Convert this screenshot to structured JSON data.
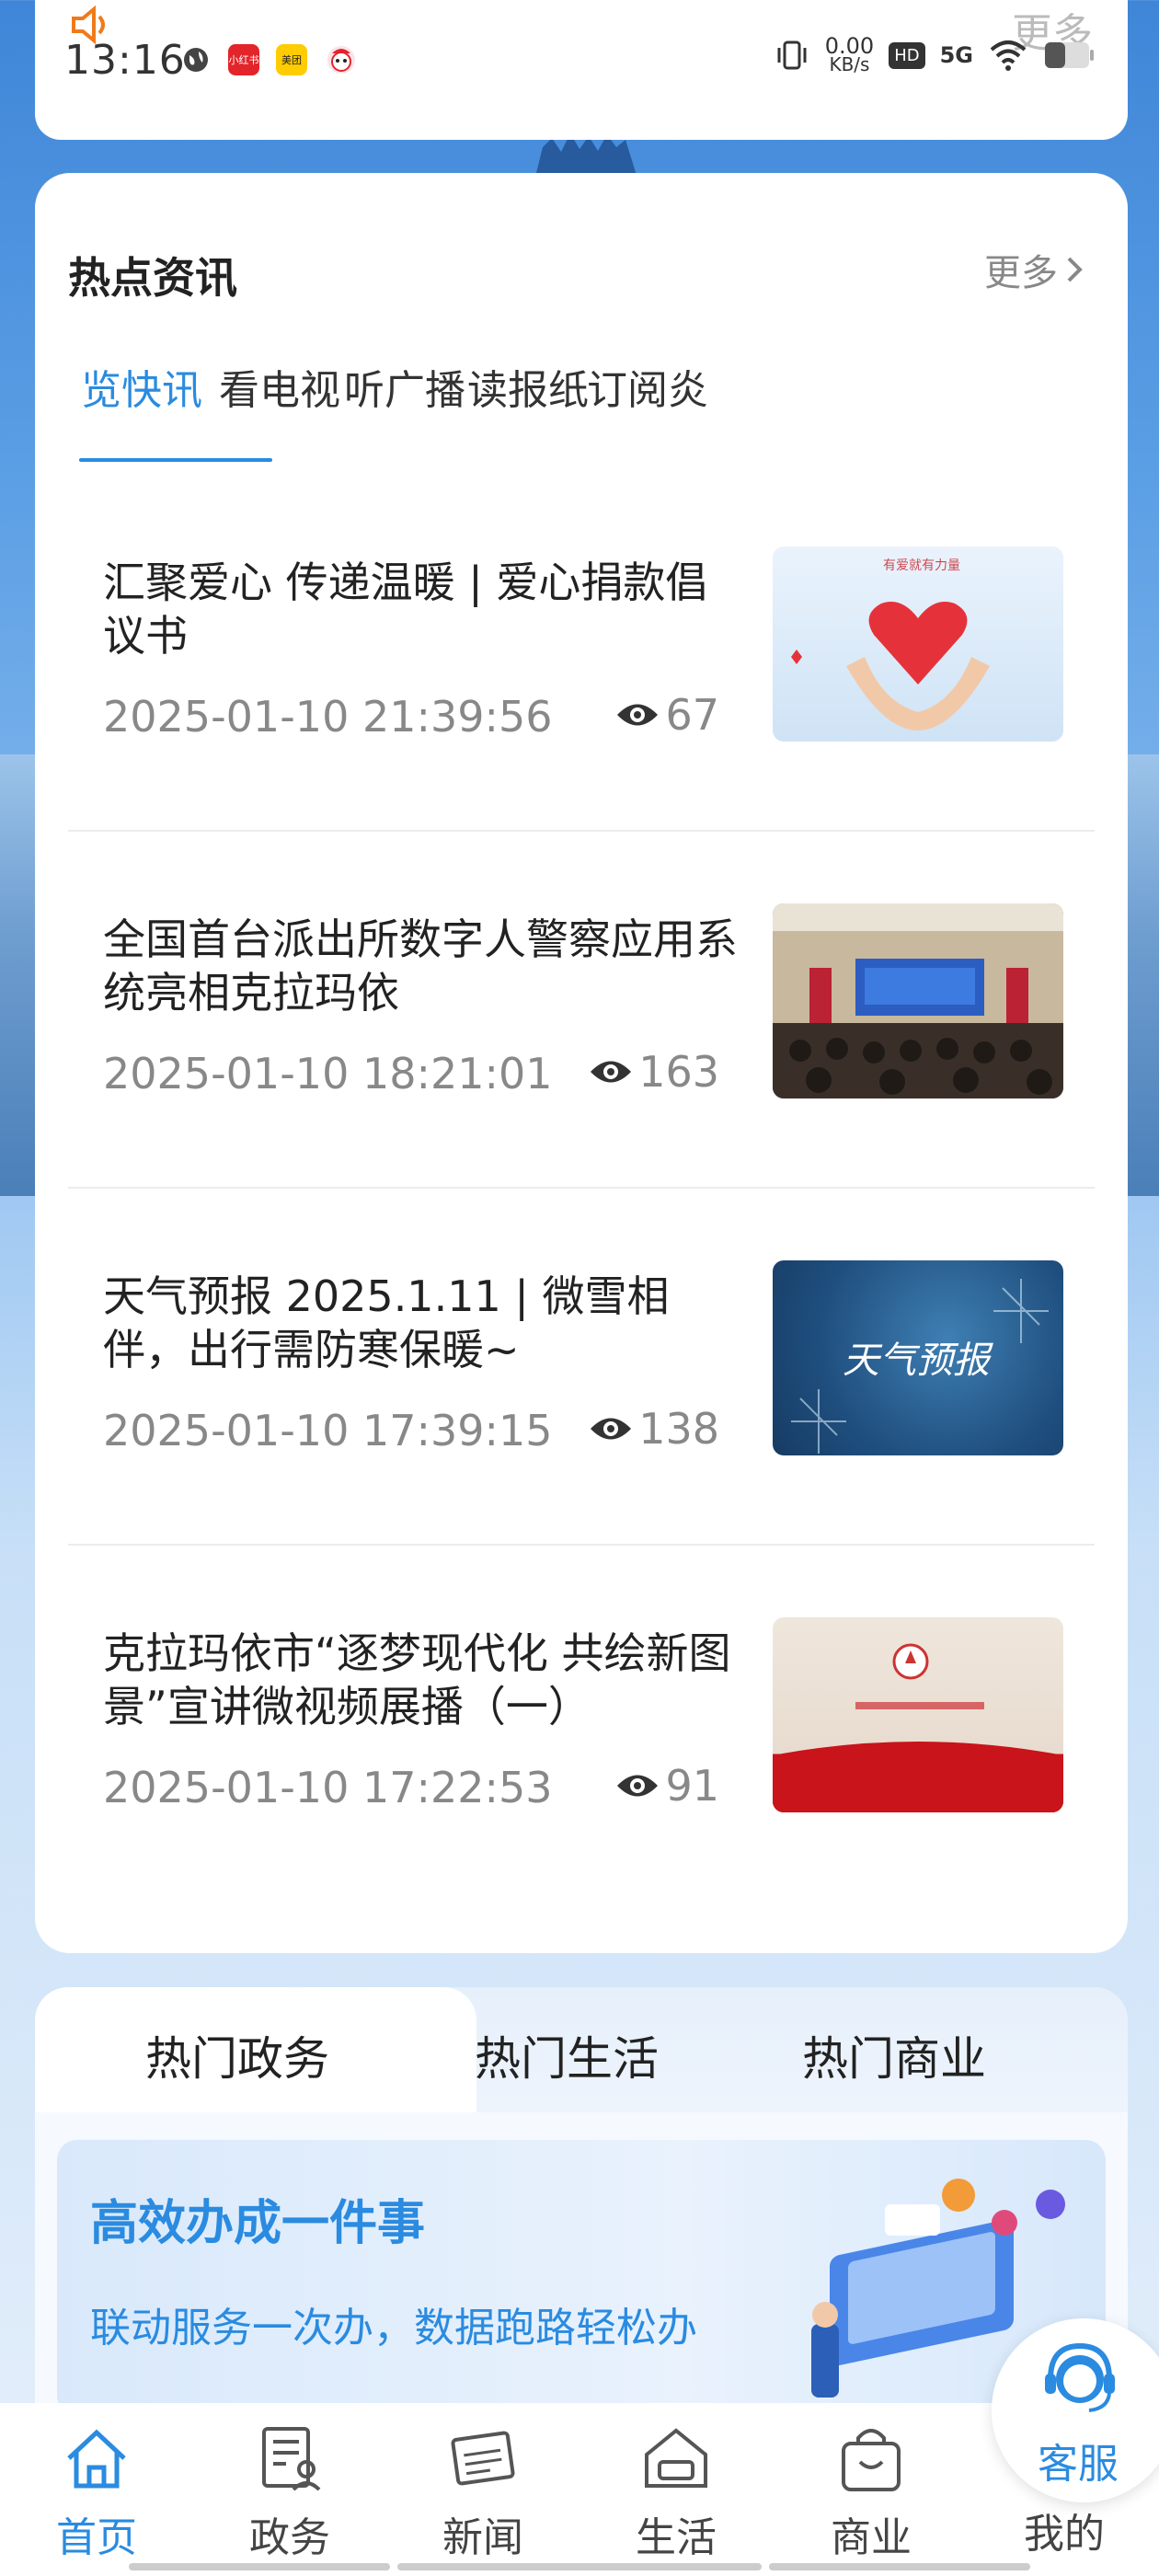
{
  "status_bar": {
    "time": "13:16",
    "speed_value": "0.00",
    "speed_unit": "KB/s",
    "hd": "HD",
    "net": "5G",
    "ghost_more": "更多",
    "apps": [
      "小红书",
      "美团"
    ]
  },
  "news": {
    "section_title": "热点资讯",
    "more_label": "更多",
    "tabs": [
      "览快讯",
      "看电视",
      "听广播",
      "读报纸",
      "订阅炎"
    ],
    "items": [
      {
        "title": "汇聚爱心 传递温暖 | 爱心捐款倡议书",
        "date": "2025-01-10 21:39:56",
        "views": "67",
        "thumb_caption": "有爱就有力量"
      },
      {
        "title": "全国首台派出所数字人警察应用系统亮相克拉玛依",
        "date": "2025-01-10 18:21:01",
        "views": "163",
        "thumb_caption": ""
      },
      {
        "title": "天气预报 2025.1.11 | 微雪相伴，出行需防寒保暖~",
        "date": "2025-01-10 17:39:15",
        "views": "138",
        "thumb_caption": "天气预报"
      },
      {
        "title": "克拉玛依市“逐梦现代化 共绘新图景”宣讲微视频展播（一）",
        "date": "2025-01-10 17:22:53",
        "views": "91",
        "thumb_caption": ""
      }
    ]
  },
  "hot": {
    "tabs": [
      "热门政务",
      "热门生活",
      "热门商业"
    ],
    "banner_title": "高效办成一件事",
    "banner_sub": "联动服务一次办，数据跑路轻松办"
  },
  "customer_service": {
    "label": "客服"
  },
  "bottom_nav": {
    "items": [
      "首页",
      "政务",
      "新闻",
      "生活",
      "商业",
      "我的"
    ]
  },
  "colors": {
    "accent": "#2a8be0"
  }
}
